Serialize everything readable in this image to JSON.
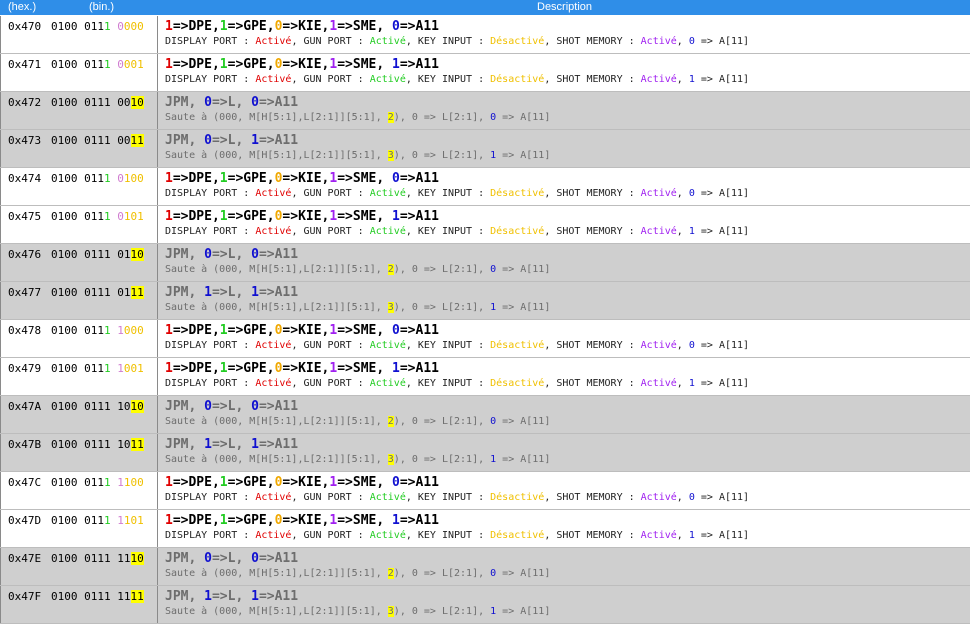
{
  "header": {
    "hex_label": "(hex.)",
    "bin_label": "(bin.)",
    "desc_label": "Description"
  },
  "rows": [
    {
      "hex": "0x470",
      "bin_a": "0100 ",
      "bin_b": "0111 ",
      "bin_c": "0000",
      "kind": "io",
      "a_val": "0",
      "v_pairs": [
        "1",
        "1",
        "0",
        "1",
        "0"
      ],
      "dpe": "Activé",
      "gpe": "Activé",
      "kie": "Désactivé",
      "sme": "Activé"
    },
    {
      "hex": "0x471",
      "bin_a": "0100 ",
      "bin_b": "0111 ",
      "bin_c": "0001",
      "kind": "io",
      "a_val": "1",
      "v_pairs": [
        "1",
        "1",
        "0",
        "1",
        "1"
      ],
      "dpe": "Activé",
      "gpe": "Activé",
      "kie": "Désactivé",
      "sme": "Activé"
    },
    {
      "hex": "0x472",
      "bin_a": "0100 ",
      "bin_b": "0111 ",
      "bin_c": "0010",
      "kind": "jp",
      "l_val": "0",
      "a_val": "0",
      "n": "2"
    },
    {
      "hex": "0x473",
      "bin_a": "0100 ",
      "bin_b": "0111 ",
      "bin_c": "0011",
      "kind": "jp",
      "l_val": "0",
      "a_val": "1",
      "n": "3"
    },
    {
      "hex": "0x474",
      "bin_a": "0100 ",
      "bin_b": "0111 ",
      "bin_c": "0100",
      "kind": "io",
      "a_val": "0"
    },
    {
      "hex": "0x475",
      "bin_a": "0100 ",
      "bin_b": "0111 ",
      "bin_c": "0101",
      "kind": "io",
      "a_val": "1"
    },
    {
      "hex": "0x476",
      "bin_a": "0100 ",
      "bin_b": "0111 ",
      "bin_c": "0110",
      "kind": "jp",
      "l_val": "0",
      "a_val": "0",
      "n": "2"
    },
    {
      "hex": "0x477",
      "bin_a": "0100 ",
      "bin_b": "0111 ",
      "bin_c": "0111",
      "kind": "jp",
      "l_val": "1",
      "a_val": "1",
      "n": "3"
    },
    {
      "hex": "0x478",
      "bin_a": "0100 ",
      "bin_b": "0111 ",
      "bin_c": "1000",
      "kind": "io",
      "a_val": "0"
    },
    {
      "hex": "0x479",
      "bin_a": "0100 ",
      "bin_b": "0111 ",
      "bin_c": "1001",
      "kind": "io",
      "a_val": "1"
    },
    {
      "hex": "0x47A",
      "bin_a": "0100 ",
      "bin_b": "0111 ",
      "bin_c": "1010",
      "kind": "jp",
      "l_val": "0",
      "a_val": "0",
      "n": "2"
    },
    {
      "hex": "0x47B",
      "bin_a": "0100 ",
      "bin_b": "0111 ",
      "bin_c": "1011",
      "kind": "jp",
      "l_val": "1",
      "a_val": "1",
      "n": "3"
    },
    {
      "hex": "0x47C",
      "bin_a": "0100 ",
      "bin_b": "0111 ",
      "bin_c": "1100",
      "kind": "io",
      "a_val": "0"
    },
    {
      "hex": "0x47D",
      "bin_a": "0100 ",
      "bin_b": "0111 ",
      "bin_c": "1101",
      "kind": "io",
      "a_val": "1"
    },
    {
      "hex": "0x47E",
      "bin_a": "0100 ",
      "bin_b": "0111 ",
      "bin_c": "1110",
      "kind": "jp",
      "l_val": "0",
      "a_val": "0",
      "n": "2"
    },
    {
      "hex": "0x47F",
      "bin_a": "0100 ",
      "bin_b": "0111 ",
      "bin_c": "1111",
      "kind": "jp",
      "l_val": "1",
      "a_val": "1",
      "n": "3"
    }
  ],
  "texts": {
    "jpm": "JPM, ",
    "arrow_l": "=>L, ",
    "arrow_a11": "=>A11",
    "saute_pre": "Saute à (000, M[H[5:1],L[2:1]][5:1], ",
    "saute_mid": "), 0 => L[2:1], ",
    "saute_end": " => A[11]",
    "dpe": "=>DPE,",
    "gpe": "=>GPE,",
    "kie": "=>KIE,",
    "sme": "=>SME, ",
    "display_port": "DISPLAY PORT : ",
    "gun_port": ", GUN PORT : ",
    "key_input": ", KEY INPUT : ",
    "shot_memory": ", SHOT MEMORY : ",
    "comma_sp": ", ",
    "a11_end": " => A[11]"
  },
  "colors": {
    "header": "#2f8ee8",
    "row_grey": "#cfcfcf",
    "dpe": "#e00000",
    "gpe": "#22cc22",
    "kie": "#f0a800",
    "sme": "#a020f0",
    "a11": "#1010d0",
    "highlight": "#ffff00"
  }
}
